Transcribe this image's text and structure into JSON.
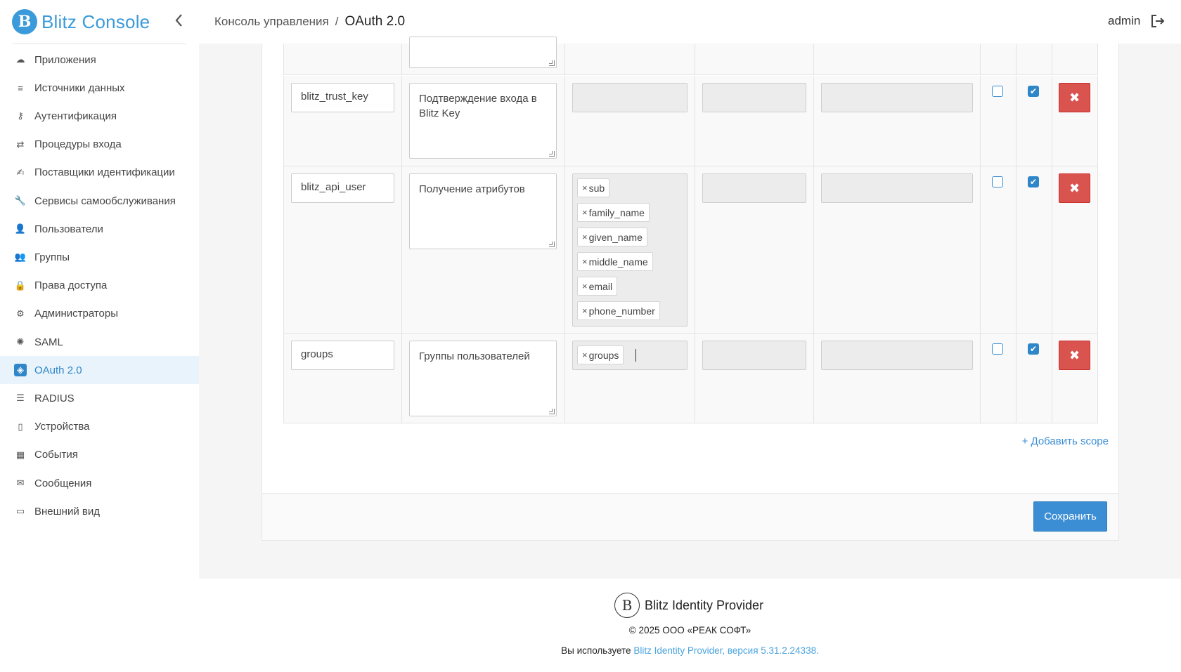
{
  "app": {
    "logo_letter": "B",
    "title": "Blitz Console"
  },
  "breadcrumb": {
    "root": "Консоль управления",
    "separator": "/",
    "current": "OAuth 2.0"
  },
  "user": {
    "name": "admin"
  },
  "sidebar": {
    "items": [
      {
        "label": "Приложения",
        "icon": "cloud-icon",
        "glyph": "☁"
      },
      {
        "label": "Источники данных",
        "icon": "database-icon",
        "glyph": "≡"
      },
      {
        "label": "Аутентификация",
        "icon": "key-icon",
        "glyph": "⚷"
      },
      {
        "label": "Процедуры входа",
        "icon": "retweet-icon",
        "glyph": "⇄"
      },
      {
        "label": "Поставщики идентификации",
        "icon": "handshake-icon",
        "glyph": "✍"
      },
      {
        "label": "Сервисы самообслуживания",
        "icon": "wrench-icon",
        "glyph": "🔧"
      },
      {
        "label": "Пользователи",
        "icon": "user-icon",
        "glyph": "👤"
      },
      {
        "label": "Группы",
        "icon": "users-icon",
        "glyph": "👥"
      },
      {
        "label": "Права доступа",
        "icon": "lock-icon",
        "glyph": "🔒"
      },
      {
        "label": "Администраторы",
        "icon": "cog-icon",
        "glyph": "⚙"
      },
      {
        "label": "SAML",
        "icon": "certificate-icon",
        "glyph": "✺"
      },
      {
        "label": "OAuth 2.0",
        "icon": "tag-icon",
        "glyph": "◈",
        "active": true
      },
      {
        "label": "RADIUS",
        "icon": "server-icon",
        "glyph": "☰"
      },
      {
        "label": "Устройства",
        "icon": "mobile-icon",
        "glyph": "▯"
      },
      {
        "label": "События",
        "icon": "calendar-icon",
        "glyph": "▦"
      },
      {
        "label": "Сообщения",
        "icon": "envelope-icon",
        "glyph": "✉"
      },
      {
        "label": "Внешний вид",
        "icon": "desktop-icon",
        "glyph": "▭"
      }
    ]
  },
  "scopes": [
    {
      "name": "blitz_trust_key",
      "description": "Подтверждение входа в Blitz Key",
      "attributes": [],
      "checkbox1": false,
      "checkbox2": true
    },
    {
      "name": "blitz_api_user",
      "description": "Получение атрибутов",
      "attributes": [
        "sub",
        "family_name",
        "given_name",
        "middle_name",
        "email",
        "phone_number"
      ],
      "checkbox1": false,
      "checkbox2": true
    },
    {
      "name": "groups",
      "description": "Группы пользователей",
      "attributes": [
        "groups"
      ],
      "checkbox1": false,
      "checkbox2": true
    }
  ],
  "tag_remove_glyph": "×",
  "delete_glyph": "✖",
  "check_glyph": "✔",
  "add_scope_label": "+ Добавить scope",
  "save_label": "Сохранить",
  "footer": {
    "product": "Blitz Identity Provider",
    "copyright": "© 2025 ООО «РЕАК СОФТ»",
    "version_prefix": "Вы используете ",
    "version_link": "Blitz Identity Provider, версия 5.31.2.24338."
  },
  "colors": {
    "accent": "#3b9ad9",
    "danger": "#d9534f",
    "active_bg": "#e8f3fb"
  }
}
